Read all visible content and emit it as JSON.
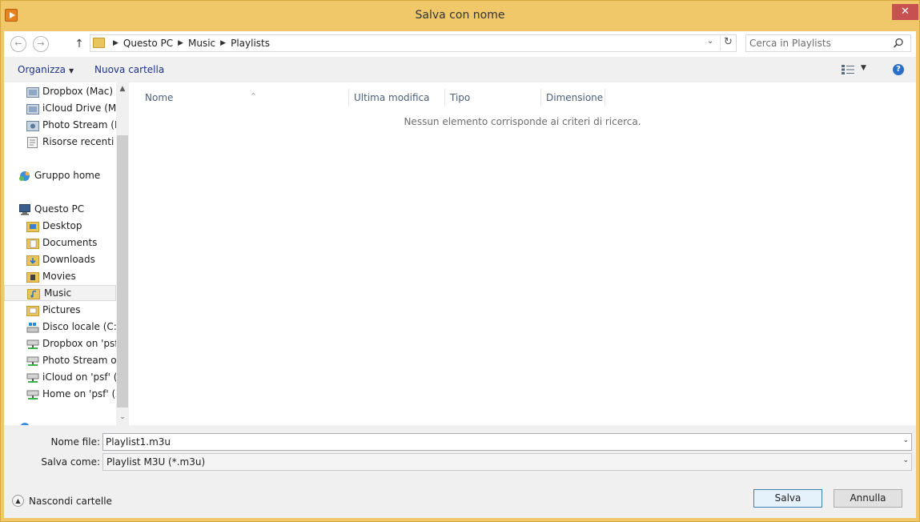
{
  "window": {
    "title": "Salva con nome",
    "close_label": "✕"
  },
  "address": {
    "crumbs": [
      "Questo PC",
      "Music",
      "Playlists"
    ]
  },
  "search": {
    "placeholder": "Cerca in Playlists"
  },
  "toolbar": {
    "organize_label": "Organizza",
    "new_folder_label": "Nuova cartella",
    "help_label": "?"
  },
  "navpane": {
    "items": [
      {
        "label": "Dropbox (Mac)",
        "icon": "dropbox-folder-icon"
      },
      {
        "label": "iCloud Drive (Ma",
        "icon": "icloud-folder-icon"
      },
      {
        "label": "Photo Stream (M",
        "icon": "photo-stream-icon"
      },
      {
        "label": "Risorse recenti",
        "icon": "recent-places-icon"
      },
      {
        "label": "Gruppo home",
        "icon": "homegroup-icon"
      },
      {
        "label": "Questo PC",
        "icon": "computer-icon"
      },
      {
        "label": "Desktop",
        "icon": "desktop-folder-icon"
      },
      {
        "label": "Documents",
        "icon": "documents-folder-icon"
      },
      {
        "label": "Downloads",
        "icon": "downloads-folder-icon"
      },
      {
        "label": "Movies",
        "icon": "movies-folder-icon"
      },
      {
        "label": "Music",
        "icon": "music-folder-icon"
      },
      {
        "label": "Pictures",
        "icon": "pictures-folder-icon"
      },
      {
        "label": "Disco locale (C:)",
        "icon": "local-disk-icon"
      },
      {
        "label": "Dropbox on 'psf'",
        "icon": "network-drive-icon"
      },
      {
        "label": "Photo Stream on",
        "icon": "network-drive-icon"
      },
      {
        "label": "iCloud on 'psf' (Y",
        "icon": "network-drive-icon"
      },
      {
        "label": "Home on 'psf' (Z",
        "icon": "network-drive-icon"
      }
    ],
    "selected": "Music"
  },
  "filelist": {
    "columns": [
      "Nome",
      "Ultima modifica",
      "Tipo",
      "Dimensione"
    ],
    "empty_message": "Nessun elemento corrisponde ai criteri di ricerca."
  },
  "form": {
    "filename_label": "Nome file:",
    "filename_value": "Playlist1.m3u",
    "savetype_label": "Salva come:",
    "savetype_value": "Playlist M3U (*.m3u)",
    "hide_folders_label": "Nascondi cartelle",
    "save_label": "Salva",
    "cancel_label": "Annulla"
  },
  "colors": {
    "frame": "#f0c86a",
    "close": "#c75050",
    "link": "#1e3287"
  }
}
